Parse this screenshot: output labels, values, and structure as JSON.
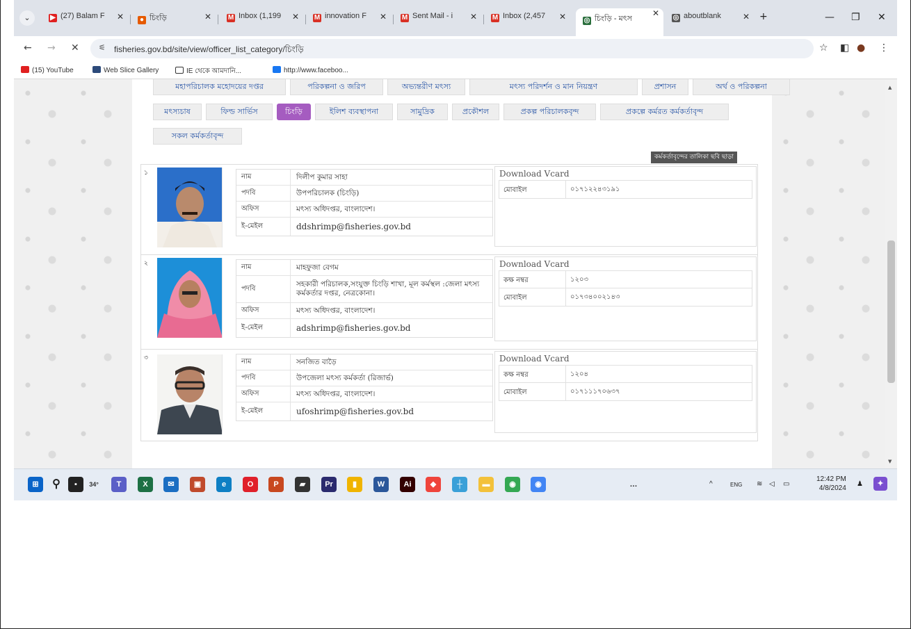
{
  "browser": {
    "tabs": [
      {
        "label": "(27) Balam F",
        "fav": "▶",
        "color": "#e02020"
      },
      {
        "label": "চিংড়ি",
        "fav": "●",
        "color": "#e65a00"
      },
      {
        "label": "Inbox (1,199",
        "fav": "M",
        "color": "#d93025"
      },
      {
        "label": "innovation F",
        "fav": "M",
        "color": "#d93025"
      },
      {
        "label": "Sent Mail - i",
        "fav": "M",
        "color": "#d93025"
      },
      {
        "label": "Inbox (2,457",
        "fav": "M",
        "color": "#d93025"
      },
      {
        "label": "চিংড়ি - মৎস",
        "fav": "◎",
        "color": "#2a6e3c"
      },
      {
        "label": "aboutblank",
        "fav": "◎",
        "color": "#555555"
      }
    ],
    "new_tab_icon": "plus-icon",
    "url": "fisheries.gov.bd/site/view/officer_list_category/চিংড়ি",
    "bookmarks": [
      {
        "label": "(15) YouTube",
        "color": "#e02020"
      },
      {
        "label": "Web Slice Gallery",
        "color": "#2c4a7a"
      },
      {
        "label": "IE থেকে আমদানি...",
        "color": "#ffffff"
      },
      {
        "label": "http://www.faceboo...",
        "color": "#1877f2"
      }
    ]
  },
  "categories": {
    "row1": [
      "মহাপরিচালক মহোদয়ের দপ্তর",
      "পরিকল্পনা ও জরিপ",
      "অভ্যন্তরীণ মৎস্য",
      "মৎস্য পরিদর্শন ও মান নিয়ন্ত্রণ",
      "প্রশাসন",
      "অর্থ ও পরিকল্পনা"
    ],
    "row2": [
      "মৎস্যচাষ",
      "ফিল্ড সার্ভিস",
      "চিংড়ি",
      "ইলিশ ব্যবস্থাপনা",
      "সামুদ্রিক",
      "প্রকৌশল",
      "প্রকল্প পরিচালকবৃন্দ",
      "প্রকল্পে কর্মরত কর্মকর্তাবৃন্দ"
    ],
    "row3": [
      "সকল কর্মকর্তাবৃন্দ"
    ],
    "active": "চিংড়ি"
  },
  "print_link": "কর্মকর্তাবৃন্দের তালিকা ছবি ছাড়া",
  "labels": {
    "name": "নাম",
    "designation": "পদবি",
    "office": "অফিস",
    "email": "ই-মেইল",
    "room": "কক্ষ নম্বর",
    "mobile": "মোবাইল",
    "vcard": "Download Vcard"
  },
  "officers": [
    {
      "serial": "১",
      "name": "দিলীপ কুমার সাহা",
      "designation": "উপপরিচালক (চিংড়ি)",
      "office": "মৎস্য অধিদপ্তর, বাংলাদেশ।",
      "email": "ddshrimp@fisheries.gov.bd",
      "room": "",
      "mobile": "০১৭১২২৪৩১৯১"
    },
    {
      "serial": "২",
      "name": "মাহফুজা বেগম",
      "designation": "সহকারী পরিচালক,সংযুক্ত চিংড়ি শাখা, মূল কর্মস্থল :জেলা মৎস্য কর্মকর্তার দপ্তর, নেত্রকোনা।",
      "office": "মৎস্য অধিদপ্তর, বাংলাদেশ।",
      "email": "adshrimp@fisheries.gov.bd",
      "room": "১২০৩",
      "mobile": "০১৭৩৪০০২১৪৩"
    },
    {
      "serial": "৩",
      "name": "সনজিত বাড়ৈ",
      "designation": "উপজেলা মৎস্য কর্মকর্তা (রিজার্ভ)",
      "office": "মৎস্য অধিদপ্তর, বাংলাদেশ।",
      "email": "ufoshrimp@fisheries.gov.bd",
      "room": "১২০৪",
      "mobile": "০১৭১১১৭০৬৩৭"
    }
  ],
  "taskbar": {
    "weather": "34°",
    "apps": [
      {
        "name": "teams",
        "color": "#5b5fc7",
        "glyph": "T"
      },
      {
        "name": "excel",
        "color": "#1d7044",
        "glyph": "X"
      },
      {
        "name": "mail",
        "color": "#1b6ec2",
        "glyph": "✉"
      },
      {
        "name": "onenote",
        "color": "#c04a2c",
        "glyph": "▣"
      },
      {
        "name": "edge",
        "color": "#0e7fc4",
        "glyph": "e"
      },
      {
        "name": "opera",
        "color": "#e0202a",
        "glyph": "O"
      },
      {
        "name": "powerpoint",
        "color": "#c8481f",
        "glyph": "P"
      },
      {
        "name": "sticky-notes",
        "color": "#333333",
        "glyph": "▰"
      },
      {
        "name": "premiere",
        "color": "#2a2a6e",
        "glyph": "Pr"
      },
      {
        "name": "file-manager",
        "color": "#f0b400",
        "glyph": "▮"
      },
      {
        "name": "word",
        "color": "#2b579a",
        "glyph": "W"
      },
      {
        "name": "illustrator",
        "color": "#330000",
        "glyph": "Ai"
      },
      {
        "name": "anydesk",
        "color": "#ef443b",
        "glyph": "◆"
      },
      {
        "name": "network",
        "color": "#3aa0d8",
        "glyph": "┼"
      },
      {
        "name": "folder",
        "color": "#f3c13a",
        "glyph": "▬"
      },
      {
        "name": "chrome",
        "color": "#34a853",
        "glyph": "◉"
      },
      {
        "name": "chrome-profile",
        "color": "#4285f4",
        "glyph": "◉"
      }
    ],
    "more": "…",
    "lang": "ENG",
    "time": "12:42 PM",
    "date": "4/8/2024"
  }
}
